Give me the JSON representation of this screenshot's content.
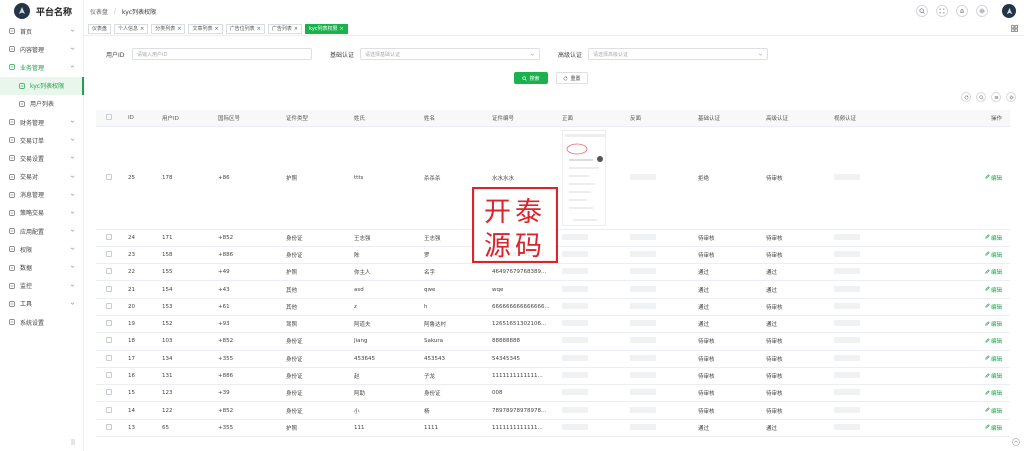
{
  "app": {
    "title": "平台名称"
  },
  "breadcrumb": {
    "home": "仪表盘",
    "current": "kyc列表权限"
  },
  "sidebar": {
    "items": [
      {
        "label": "首页",
        "icon": "home-icon",
        "chev": true
      },
      {
        "label": "内容管理",
        "icon": "document-icon",
        "chev": true
      },
      {
        "label": "业务管理",
        "icon": "user-group-icon",
        "chev": true,
        "open": true
      },
      {
        "label": "kyc列表权限",
        "icon": "list-icon",
        "sub": true,
        "active": true
      },
      {
        "label": "用户列表",
        "icon": "user-icon",
        "sub": true
      },
      {
        "label": "财务管理",
        "icon": "wallet-icon",
        "chev": true
      },
      {
        "label": "交易订单",
        "icon": "order-icon",
        "chev": true
      },
      {
        "label": "交易设置",
        "icon": "setting-icon",
        "chev": true
      },
      {
        "label": "交易对",
        "icon": "swap-icon",
        "chev": true
      },
      {
        "label": "消息管理",
        "icon": "message-icon",
        "chev": true
      },
      {
        "label": "策略交易",
        "icon": "chart-icon",
        "chev": true
      },
      {
        "label": "应用配置",
        "icon": "app-icon",
        "chev": true
      },
      {
        "label": "权限",
        "icon": "lock-icon",
        "chev": true
      },
      {
        "label": "数据",
        "icon": "database-icon",
        "chev": true
      },
      {
        "label": "监控",
        "icon": "monitor-icon",
        "chev": true
      },
      {
        "label": "工具",
        "icon": "tool-icon",
        "chev": true
      },
      {
        "label": "系统设置",
        "icon": "gear-icon",
        "chev": false
      }
    ]
  },
  "tags": [
    {
      "label": "仪表盘",
      "closable": false
    },
    {
      "label": "个人信息",
      "closable": true
    },
    {
      "label": "分类列表",
      "closable": true
    },
    {
      "label": "文章列表",
      "closable": true
    },
    {
      "label": "广告位列表",
      "closable": true
    },
    {
      "label": "广告列表",
      "closable": true
    },
    {
      "label": "kyc列表权限",
      "closable": true,
      "active": true
    }
  ],
  "search": {
    "user_id_label": "用户ID",
    "user_id_placeholder": "请输入用户ID",
    "basic_label": "基础认证",
    "basic_placeholder": "请选择基础认证",
    "advanced_label": "高级认证",
    "advanced_placeholder": "请选择高级认证",
    "search_btn": "搜索",
    "reset_btn": "重置"
  },
  "table": {
    "columns": [
      "ID",
      "用户ID",
      "国际区号",
      "证件类型",
      "姓氏",
      "姓名",
      "证件编号",
      "正面",
      "反面",
      "基础认证",
      "高级认证",
      "视频认证",
      "操作"
    ],
    "edit_label": "编辑",
    "rows": [
      {
        "id": "25",
        "uid": "178",
        "code": "+86",
        "type": "护照",
        "last": "ttts",
        "first": "杀杀杀",
        "doc": "水水水水",
        "basic": "拒绝",
        "adv": "待审核",
        "big": true
      },
      {
        "id": "24",
        "uid": "171",
        "code": "+852",
        "type": "身份证",
        "last": "王志强",
        "first": "王志强",
        "doc": "",
        "basic": "待审核",
        "adv": "待审核"
      },
      {
        "id": "23",
        "uid": "158",
        "code": "+886",
        "type": "身份证",
        "last": "陈",
        "first": "罗",
        "doc": "559633856911456",
        "basic": "待审核",
        "adv": "待审核"
      },
      {
        "id": "22",
        "uid": "155",
        "code": "+49",
        "type": "护照",
        "last": "你主人",
        "first": "名字",
        "doc": "46497679768389...",
        "basic": "通过",
        "adv": "通过"
      },
      {
        "id": "21",
        "uid": "154",
        "code": "+43",
        "type": "其他",
        "last": "asd",
        "first": "qwe",
        "doc": "wqe",
        "basic": "通过",
        "adv": "通过"
      },
      {
        "id": "20",
        "uid": "153",
        "code": "+61",
        "type": "其他",
        "last": "z",
        "first": "h",
        "doc": "666666666666666...",
        "basic": "通过",
        "adv": "待审核"
      },
      {
        "id": "19",
        "uid": "152",
        "code": "+93",
        "type": "驾照",
        "last": "阿道夫",
        "first": "阿鲁达村",
        "doc": "12651651302106...",
        "basic": "通过",
        "adv": "通过"
      },
      {
        "id": "18",
        "uid": "103",
        "code": "+852",
        "type": "身份证",
        "last": "Jiang",
        "first": "Sakura",
        "doc": "88888888",
        "basic": "待审核",
        "adv": "待审核"
      },
      {
        "id": "17",
        "uid": "134",
        "code": "+355",
        "type": "身份证",
        "last": "453645",
        "first": "453543",
        "doc": "54345345",
        "basic": "待审核",
        "adv": "待审核"
      },
      {
        "id": "16",
        "uid": "131",
        "code": "+886",
        "type": "身份证",
        "last": "赵",
        "first": "子龙",
        "doc": "1111111111111...",
        "basic": "待审核",
        "adv": "待审核"
      },
      {
        "id": "15",
        "uid": "123",
        "code": "+39",
        "type": "身份证",
        "last": "阿助",
        "first": "身份证",
        "doc": "008",
        "basic": "待审核",
        "adv": "待审核"
      },
      {
        "id": "14",
        "uid": "122",
        "code": "+852",
        "type": "身份证",
        "last": "小",
        "first": "杨",
        "doc": "78978978978978...",
        "basic": "待审核",
        "adv": "待审核"
      },
      {
        "id": "13",
        "uid": "65",
        "code": "+355",
        "type": "护照",
        "last": "111",
        "first": "1111",
        "doc": "1111111111111...",
        "basic": "通过",
        "adv": "通过"
      }
    ]
  },
  "watermark": {
    "line1": "开泰",
    "line2": "源码"
  },
  "colors": {
    "accent": "#1ab24c",
    "seal": "#d8262c",
    "sidebar_dark": "#233547"
  }
}
